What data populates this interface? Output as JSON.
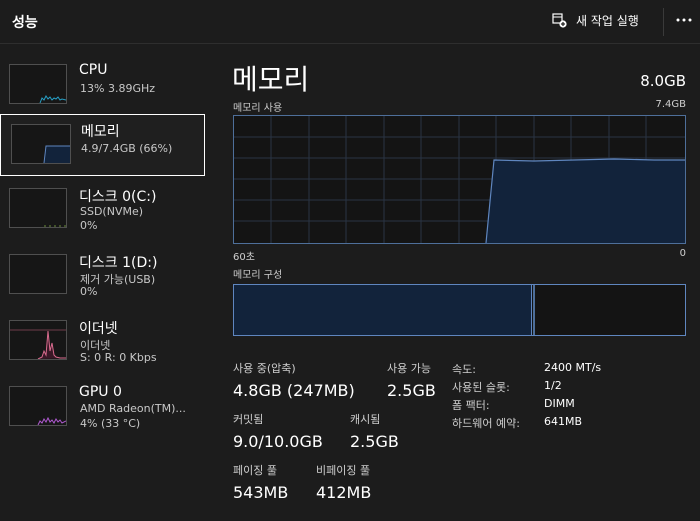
{
  "header": {
    "title": "성능",
    "new_task_label": "새 작업 실행"
  },
  "sidebar": {
    "items": [
      {
        "title": "CPU",
        "sub1": "13% 3.89GHz",
        "sub2": ""
      },
      {
        "title": "메모리",
        "sub1": "4.9/7.4GB (66%)",
        "sub2": ""
      },
      {
        "title": "디스크 0(C:)",
        "sub1": "SSD(NVMe)",
        "sub2": "0%"
      },
      {
        "title": "디스크 1(D:)",
        "sub1": "제거 가능(USB)",
        "sub2": "0%"
      },
      {
        "title": "이더넷",
        "sub1": "이더넷",
        "sub2": "S: 0 R: 0 Kbps"
      },
      {
        "title": "GPU 0",
        "sub1": "AMD Radeon(TM)...",
        "sub2": "4% (33 °C)"
      }
    ]
  },
  "main": {
    "title": "메모리",
    "total": "8.0GB",
    "usage_label": "메모리 사용",
    "usage_max": "7.4GB",
    "time_left": "60초",
    "time_right": "0",
    "composition_label": "메모리 구성"
  },
  "stats": {
    "in_use_label": "사용 중(압축)",
    "in_use_value": "4.8GB (247MB)",
    "available_label": "사용 가능",
    "available_value": "2.5GB",
    "committed_label": "커밋됨",
    "committed_value": "9.0/10.0GB",
    "cached_label": "캐시됨",
    "cached_value": "2.5GB",
    "paged_label": "페이징 풀",
    "paged_value": "543MB",
    "nonpaged_label": "비페이징 풀",
    "nonpaged_value": "412MB"
  },
  "details": [
    {
      "label": "속도:",
      "value": "2400 MT/s"
    },
    {
      "label": "사용된 슬롯:",
      "value": "1/2"
    },
    {
      "label": "폼 팩터:",
      "value": "DIMM"
    },
    {
      "label": "하드웨어 예약:",
      "value": "641MB"
    }
  ],
  "colors": {
    "memory_line": "#5f86bf",
    "memory_fill": "#12233b",
    "cpu_line": "#27a0c6",
    "ethernet_line": "#d96b8e",
    "gpu_line": "#b05ad1"
  }
}
